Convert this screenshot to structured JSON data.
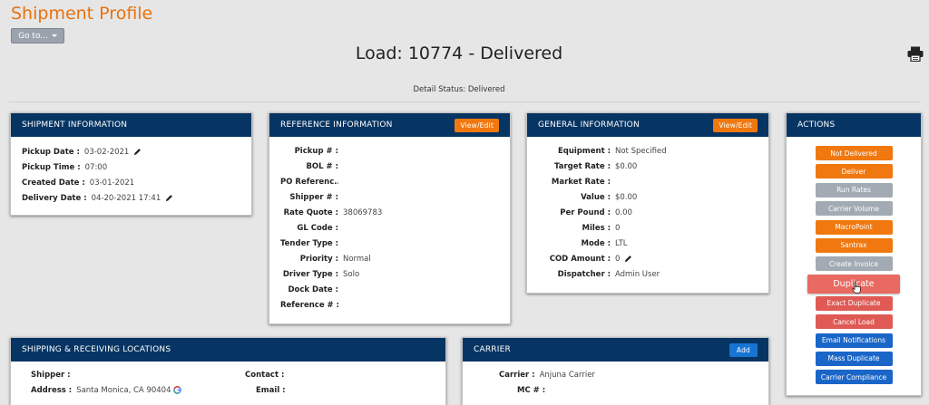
{
  "page": {
    "title": "Shipment Profile",
    "goto_label": "Go to..."
  },
  "load": {
    "title": "Load: 10774 - Delivered",
    "detail_status": "Detail Status: Delivered"
  },
  "shipment_info": {
    "header": "SHIPMENT INFORMATION",
    "rows": [
      {
        "label": "Pickup Date :",
        "value": "03-02-2021",
        "editable": true
      },
      {
        "label": "Pickup Time :",
        "value": "07:00",
        "editable": false
      },
      {
        "label": "Created Date :",
        "value": "03-01-2021",
        "editable": false
      },
      {
        "label": "Delivery Date :",
        "value": "04-20-2021 17:41",
        "editable": true
      }
    ]
  },
  "reference_info": {
    "header": "REFERENCE INFORMATION",
    "button": "View/Edit",
    "rows": [
      {
        "label": "Pickup # :",
        "value": ""
      },
      {
        "label": "BOL # :",
        "value": ""
      },
      {
        "label": "PO Referenc...",
        "value": ""
      },
      {
        "label": "Shipper # :",
        "value": ""
      },
      {
        "label": "Rate Quote :",
        "value": "38069783"
      },
      {
        "label": "GL Code :",
        "value": ""
      },
      {
        "label": "Tender Type :",
        "value": ""
      },
      {
        "label": "Priority :",
        "value": "Normal"
      },
      {
        "label": "Driver Type :",
        "value": "Solo"
      },
      {
        "label": "Dock Date :",
        "value": ""
      },
      {
        "label": "Reference # :",
        "value": ""
      }
    ]
  },
  "general_info": {
    "header": "GENERAL INFORMATION",
    "button": "View/Edit",
    "rows": [
      {
        "label": "Equipment :",
        "value": "Not Specified",
        "editable": false
      },
      {
        "label": "Target Rate :",
        "value": "$0.00",
        "editable": false
      },
      {
        "label": "Market Rate :",
        "value": "",
        "editable": false
      },
      {
        "label": "Value :",
        "value": "$0.00",
        "editable": false
      },
      {
        "label": "Per Pound :",
        "value": "0.00",
        "editable": false
      },
      {
        "label": "Miles :",
        "value": "0",
        "editable": false
      },
      {
        "label": "Mode :",
        "value": "LTL",
        "editable": false
      },
      {
        "label": "COD Amount :",
        "value": "0",
        "editable": true
      },
      {
        "label": "Dispatcher :",
        "value": "Admin User",
        "editable": false
      }
    ]
  },
  "actions": {
    "header": "ACTIONS",
    "buttons": [
      {
        "label": "Not Delivered",
        "color": "orange"
      },
      {
        "label": "Deliver",
        "color": "orange"
      },
      {
        "label": "Run Rates",
        "color": "gray"
      },
      {
        "label": "Carrier Volume",
        "color": "gray"
      },
      {
        "label": "MacroPoint",
        "color": "orange"
      },
      {
        "label": "Santrax",
        "color": "orange"
      },
      {
        "label": "Create Invoice",
        "color": "gray"
      },
      {
        "label": "Duplicate",
        "color": "red-hover"
      },
      {
        "label": "Exact Duplicate",
        "color": "red"
      },
      {
        "label": "Cancel Load",
        "color": "red"
      },
      {
        "label": "Email Notifications",
        "color": "blue"
      },
      {
        "label": "Mass Duplicate",
        "color": "blue"
      },
      {
        "label": "Carrier Compliance",
        "color": "blue"
      }
    ]
  },
  "locations": {
    "header": "SHIPPING & RECEIVING LOCATIONS",
    "shipper_label": "Shipper :",
    "address_label": "Address :",
    "address_value": "Santa Monica, CA 90404",
    "contact_label": "Contact :",
    "email_label": "Email :"
  },
  "carrier": {
    "header": "CARRIER",
    "button": "Add",
    "carrier_label": "Carrier :",
    "carrier_value": "Anjuna Carrier",
    "mc_label": "MC # :"
  },
  "colors": {
    "accent_orange": "#f0780f",
    "header_navy": "#073563",
    "title_orange": "#e8720c",
    "danger": "#e05a55",
    "primary_blue": "#1a66c8"
  }
}
